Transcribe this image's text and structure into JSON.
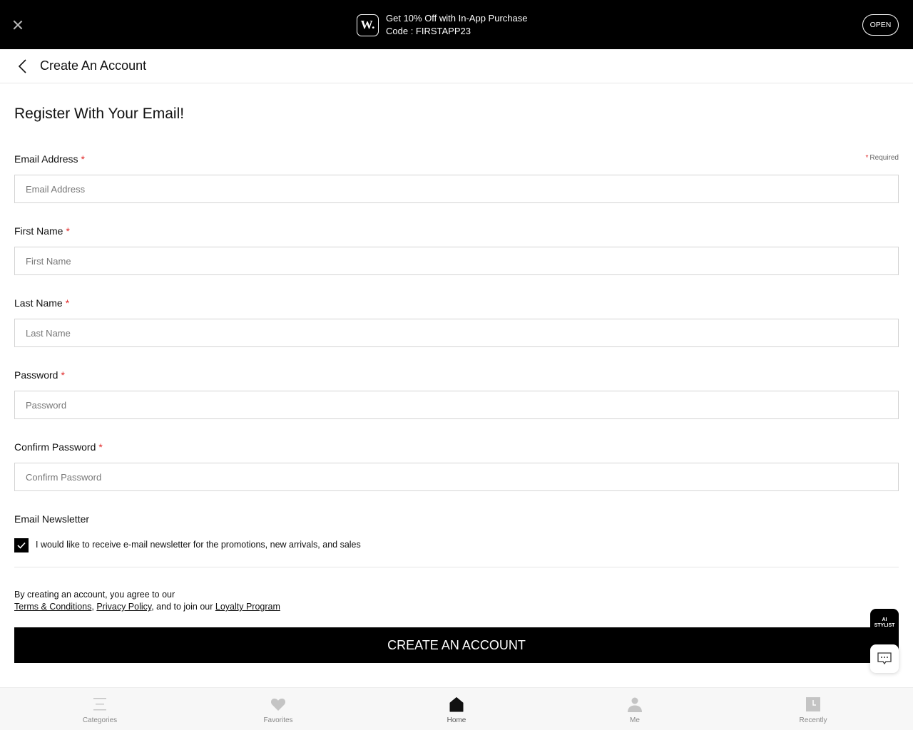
{
  "promo": {
    "logo_text": "W.",
    "line1": "Get 10% Off with In-App Purchase",
    "line2": "Code : FIRSTAPP23",
    "open_label": "OPEN",
    "close_icon": "close-icon"
  },
  "header": {
    "back_icon": "chevron-left-icon",
    "title": "Create An Account"
  },
  "form": {
    "heading": "Register With Your Email!",
    "required_note": "Required",
    "required_star": "*",
    "fields": [
      {
        "label": "Email Address",
        "placeholder": "Email Address",
        "value": ""
      },
      {
        "label": "First Name",
        "placeholder": "First Name",
        "value": ""
      },
      {
        "label": "Last Name",
        "placeholder": "Last Name",
        "value": ""
      },
      {
        "label": "Password",
        "placeholder": "Password",
        "value": ""
      },
      {
        "label": "Confirm Password",
        "placeholder": "Confirm Password",
        "value": ""
      }
    ],
    "newsletter": {
      "label": "Email Newsletter",
      "checkbox_text": "I would like to receive e-mail newsletter for the promotions, new arrivals, and sales",
      "checked": true
    },
    "agreement": {
      "line1": "By creating an account, you agree to our",
      "terms": "Terms & Conditions",
      "comma": ",",
      "privacy": "Privacy Policy",
      "middle": ", and to join our",
      "loyalty": "Loyalty Program"
    },
    "submit_label": "CREATE AN ACCOUNT"
  },
  "floating": {
    "ai_stylist_line1": "AI",
    "ai_stylist_line2": "STYLIST",
    "chat_icon": "chat-icon"
  },
  "bottom_nav": [
    {
      "label": "Categories",
      "icon": "menu-icon",
      "active": false
    },
    {
      "label": "Favorites",
      "icon": "heart-icon",
      "active": false
    },
    {
      "label": "Home",
      "icon": "home-icon",
      "active": true
    },
    {
      "label": "Me",
      "icon": "user-icon",
      "active": false
    },
    {
      "label": "Recently",
      "icon": "clock-icon",
      "active": false
    }
  ],
  "colors": {
    "accent": "#000000",
    "required_star": "#e12b2b",
    "nav_inactive": "#c4c4c4"
  }
}
